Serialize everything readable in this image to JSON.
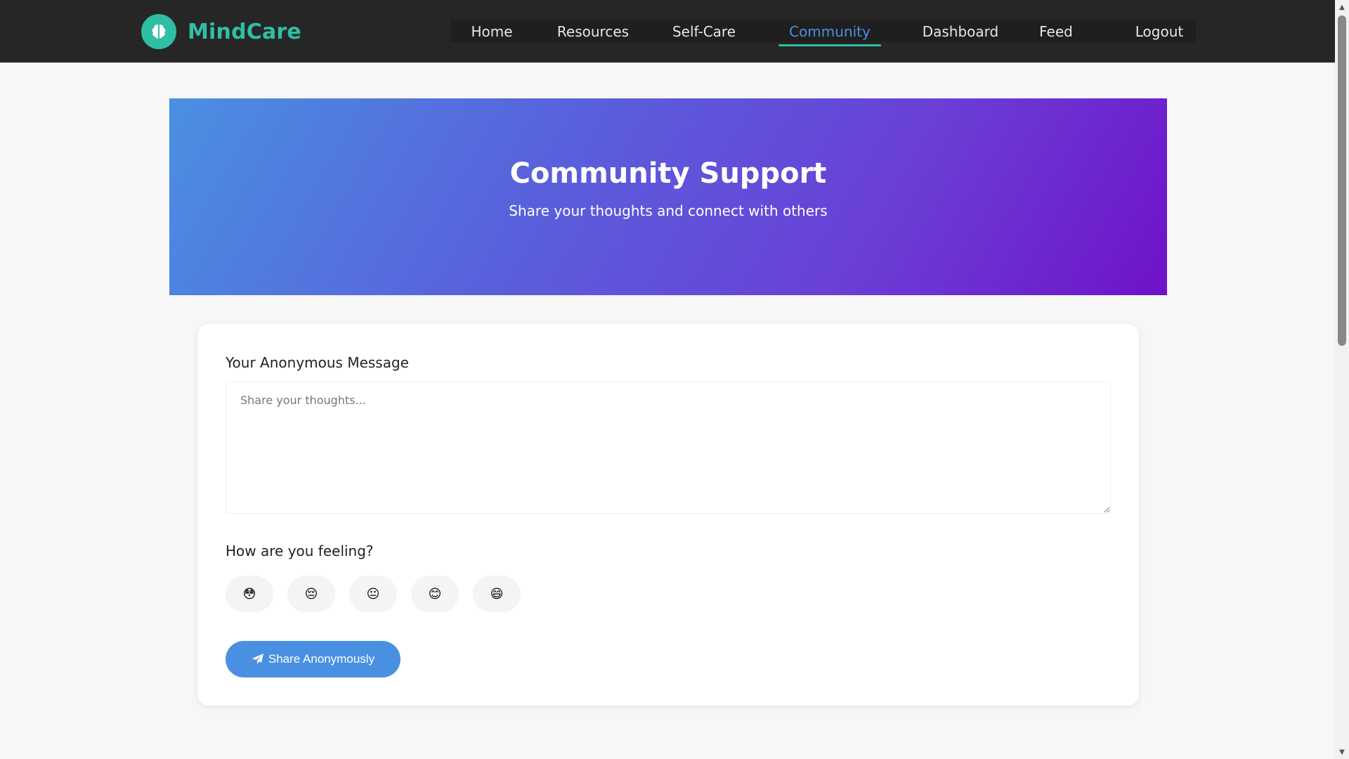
{
  "brand": {
    "name": "MindCare",
    "logo_icon": "brain-icon",
    "color": "#2ebfa5"
  },
  "nav": {
    "items": [
      {
        "label": "Home",
        "active": false
      },
      {
        "label": "Resources",
        "active": false
      },
      {
        "label": "Self-Care",
        "active": false
      },
      {
        "label": "Community",
        "active": true
      },
      {
        "label": "Dashboard",
        "active": false
      },
      {
        "label": "Feed",
        "active": false
      },
      {
        "label": "Logout",
        "active": false
      }
    ],
    "active_color": "#4a90e2"
  },
  "hero": {
    "title": "Community Support",
    "subtitle": "Share your thoughts and connect with others"
  },
  "form": {
    "message_label": "Your Anonymous Message",
    "message_placeholder": "Share your thoughts...",
    "message_value": "",
    "feeling_label": "How are you feeling?",
    "moods": [
      {
        "emoji": "😳"
      },
      {
        "emoji": "😔"
      },
      {
        "emoji": "😐"
      },
      {
        "emoji": "😊"
      },
      {
        "emoji": "😄"
      }
    ],
    "submit_label": "Share Anonymously",
    "submit_icon": "paper-plane-icon",
    "accent_color": "#4a90e2"
  }
}
